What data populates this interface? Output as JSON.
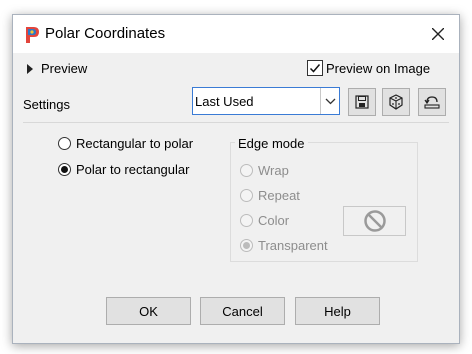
{
  "window": {
    "title": "Polar Coordinates",
    "close_icon": "close-icon",
    "app_icon": "paintshop-pro-icon"
  },
  "preview": {
    "label": "Preview",
    "preview_on_image_label": "Preview on Image",
    "preview_on_image_checked": true
  },
  "settings": {
    "label": "Settings",
    "preset_value": "Last Used",
    "toolbar_icons": [
      "save-preset-icon",
      "random-settings-icon",
      "reset-icon"
    ]
  },
  "conversion": {
    "options": [
      "Rectangular to polar",
      "Polar to rectangular"
    ],
    "selected": "Polar to rectangular"
  },
  "edge_mode": {
    "title": "Edge mode",
    "options": [
      "Wrap",
      "Repeat",
      "Color",
      "Transparent"
    ],
    "selected": "Transparent",
    "enabled": false,
    "color_swatch_icon": "no-color-icon"
  },
  "buttons": {
    "ok": "OK",
    "cancel": "Cancel",
    "help": "Help"
  },
  "colors": {
    "dialog_bg": "#f0f0f0",
    "title_bg": "#ffffff",
    "focus_border": "#3a7bd5",
    "disabled_text": "#8d8d8d"
  }
}
